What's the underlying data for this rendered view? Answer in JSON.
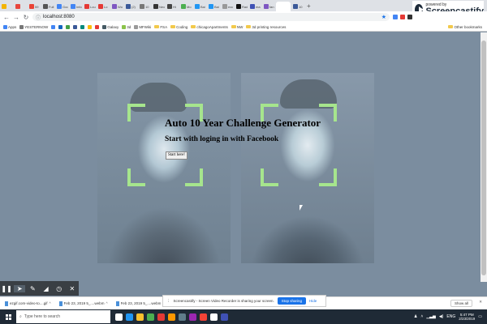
{
  "browser": {
    "tabs": [
      {
        "label": "",
        "color": "#f4b400"
      },
      {
        "label": "",
        "color": "#e8453c"
      },
      {
        "label": "59",
        "color": "#ea4335"
      },
      {
        "label": "Full",
        "color": "#555555"
      },
      {
        "label": "Goo",
        "color": "#4285f4"
      },
      {
        "label": "Info",
        "color": "#4285f4"
      },
      {
        "label": "Lou",
        "color": "#e53935"
      },
      {
        "label": "Lo",
        "color": "#e53935"
      },
      {
        "label": "Wo",
        "color": "#7e57c2"
      },
      {
        "label": "(2)",
        "color": "#3b5998"
      },
      {
        "label": "10",
        "color": "#777777"
      },
      {
        "label": "Neo",
        "color": "#333333"
      },
      {
        "label": "Hi",
        "color": "#444444"
      },
      {
        "label": "Mo",
        "color": "#4caf50"
      },
      {
        "label": "Bai",
        "color": "#2196f3"
      },
      {
        "label": "Bai",
        "color": "#2196f3"
      },
      {
        "label": "exc",
        "color": "#999999"
      },
      {
        "label": "Rad",
        "color": "#111111"
      },
      {
        "label": "ma",
        "color": "#3f51b5"
      },
      {
        "label": "fan",
        "color": "#7e57c2"
      },
      {
        "label": "",
        "color": "#ffffff",
        "active": true
      },
      {
        "label": "10",
        "color": "#3b5998"
      }
    ],
    "url": "localhost:8080",
    "bookmarks": [
      {
        "label": "Apps",
        "type": "apps"
      },
      {
        "label": "YESTERNOW",
        "color": "#777777"
      },
      {
        "label": "",
        "color": "#4285f4"
      },
      {
        "label": "",
        "color": "#1565c0"
      },
      {
        "label": "",
        "color": "#43a047"
      },
      {
        "label": "",
        "color": "#3b5998"
      },
      {
        "label": "",
        "color": "#00897b"
      },
      {
        "label": "",
        "color": "#fbbc05"
      },
      {
        "label": "",
        "color": "#e53935"
      },
      {
        "label": "Galaxy",
        "color": "#455a64"
      },
      {
        "label": "3d",
        "color": "#8bc34a"
      },
      {
        "label": "MFWiki",
        "color": "#999999"
      },
      {
        "label": "FSA",
        "type": "folder"
      },
      {
        "label": "Coding",
        "type": "folder"
      },
      {
        "label": "chicagoApartments",
        "type": "folder"
      },
      {
        "label": "NW",
        "type": "folder"
      },
      {
        "label": "3d printing resources",
        "type": "folder"
      }
    ],
    "other_bookmarks": "Other bookmarks"
  },
  "screencastify_badge": {
    "small": "powered by",
    "big": "Screencastify"
  },
  "page": {
    "headline": "Auto 10 Year Challenge Generator",
    "subline": "Start with loging in with Facebook",
    "start_button": "Start here!"
  },
  "share_notice": {
    "message": "Screencastify - Screen Video Recorder is sharing your screen.",
    "stop_label": "Stop sharing",
    "hide_label": "Hide"
  },
  "downloads": {
    "items": [
      "ezgif.com-video-to....gif",
      "Feb 23, 2019 5_....webm",
      "Feb 23, 2019 5_....webm"
    ],
    "show_all": "Show all"
  },
  "taskbar": {
    "search_placeholder": "Type here to search",
    "apps": [
      "#ffffff",
      "#2196f3",
      "#fbc02d",
      "#4caf50",
      "#e53935",
      "#ff9800",
      "#607d8b",
      "#9c27b0",
      "#f44336",
      "#ffffff",
      "#3f51b5"
    ],
    "lang": "ENG",
    "time": "5:47 PM",
    "date": "2/23/2019"
  }
}
